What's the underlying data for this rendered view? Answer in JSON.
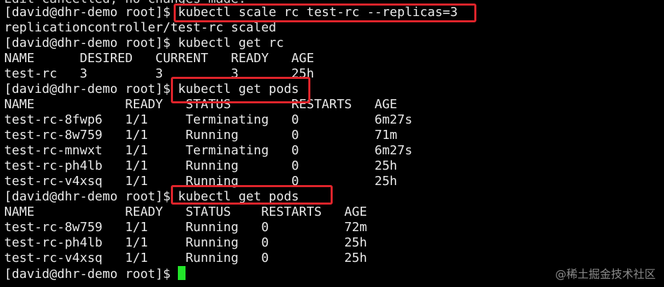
{
  "terminal": {
    "lines": [
      "Edit cancelled, no changes made.",
      "[david@dhr-demo root]$ kubectl scale rc test-rc --replicas=3",
      "replicationcontroller/test-rc scaled",
      "[david@dhr-demo root]$ kubectl get rc",
      "NAME      DESIRED   CURRENT   READY   AGE",
      "test-rc   3         3         3       25h",
      "[david@dhr-demo root]$ kubectl get pods",
      "NAME            READY   STATUS        RESTARTS   AGE",
      "test-rc-8fwp6   1/1     Terminating   0          6m27s",
      "test-rc-8w759   1/1     Running       0          71m",
      "test-rc-mnwxt   1/1     Terminating   0          6m27s",
      "test-rc-ph4lb   1/1     Running       0          25h",
      "test-rc-v4xsq   1/1     Running       0          25h",
      "[david@dhr-demo root]$ kubectl get pods",
      "NAME            READY   STATUS    RESTARTS   AGE",
      "test-rc-8w759   1/1     Running   0          72m",
      "test-rc-ph4lb   1/1     Running   0          25h",
      "test-rc-v4xsq   1/1     Running   0          25h"
    ],
    "prompt": "[david@dhr-demo root]$ "
  },
  "colors": {
    "background": "#000000",
    "text": "#e8e8e8",
    "highlight_box": "#e0242b",
    "cursor": "#22e52a"
  },
  "watermark": "@稀土掘金技术社区"
}
